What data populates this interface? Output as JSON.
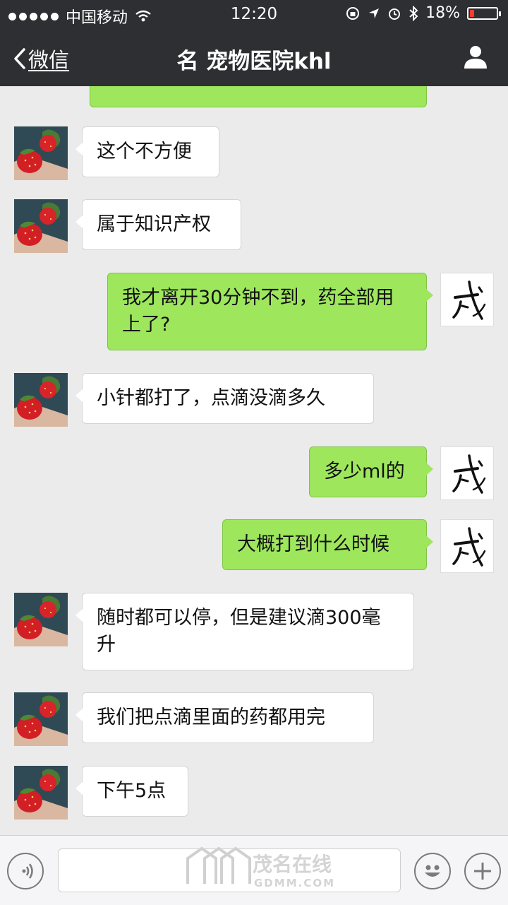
{
  "status": {
    "carrier": "中国移动",
    "time": "12:20",
    "battery": "18%",
    "battery_level": 0.18
  },
  "nav": {
    "back_label": "微信",
    "title": "名 宠物医院khl"
  },
  "messages": [
    {
      "side": "in",
      "text": "这个不方便"
    },
    {
      "side": "in",
      "text": "属于知识产权"
    },
    {
      "side": "out",
      "text": "我才离开30分钟不到，药全部用上了?"
    },
    {
      "side": "in",
      "text": "小针都打了，点滴没滴多久"
    },
    {
      "side": "out",
      "text": "多少ml的"
    },
    {
      "side": "out",
      "text": "大概打到什么时候"
    },
    {
      "side": "in",
      "text": "随时都可以停，但是建议滴300毫升"
    },
    {
      "side": "in",
      "text": "我们把点滴里面的药都用完"
    },
    {
      "side": "in",
      "text": "下午5点"
    }
  ],
  "watermark": {
    "text": "茂名在线",
    "url_text": "GDMM.COM"
  },
  "icons": {
    "back": "chevron-left-icon",
    "person": "person-icon",
    "voice": "voice-icon",
    "emoji": "emoji-icon",
    "plus": "plus-icon",
    "wifi": "wifi-icon"
  },
  "colors": {
    "nav_bg": "#2e2f33",
    "out_bubble": "#9ee75d",
    "in_bubble": "#ffffff",
    "chat_bg": "#ebebeb"
  }
}
